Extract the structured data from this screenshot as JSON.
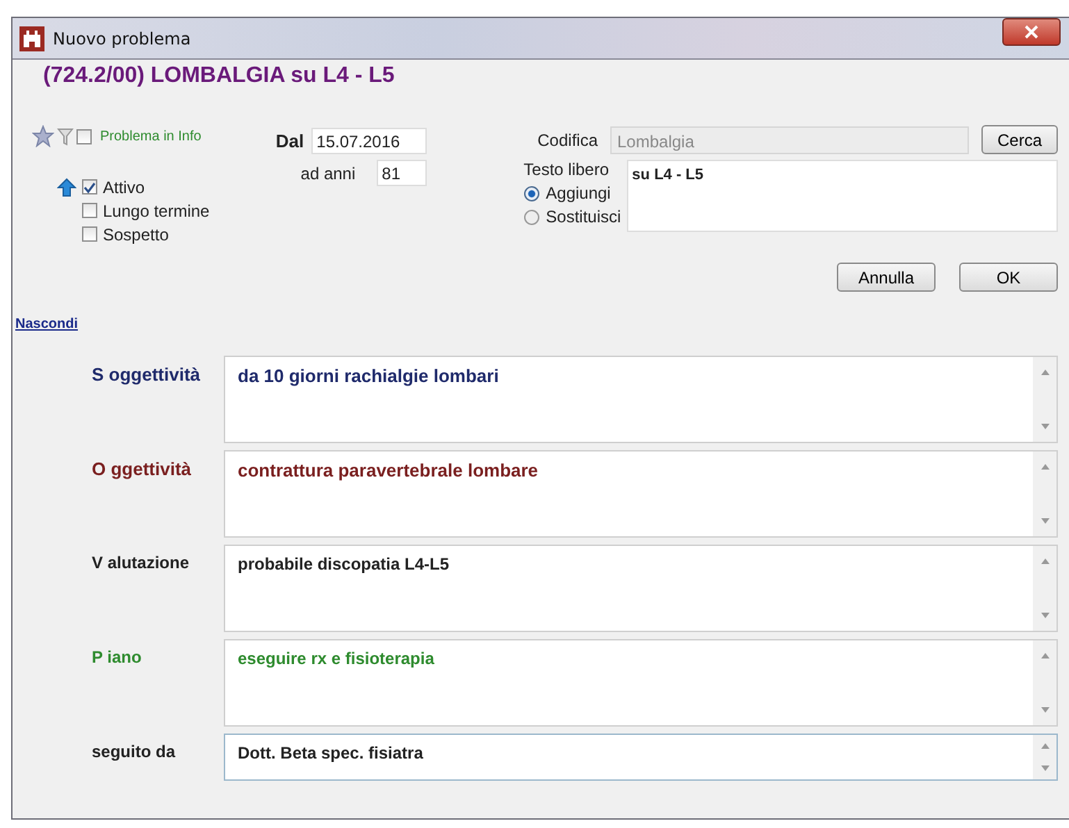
{
  "window": {
    "title": "Nuovo problema"
  },
  "heading": "(724.2/00) LOMBALGIA su L4 - L5",
  "info": {
    "label": "Problema in Info",
    "checked": false
  },
  "flags": [
    {
      "label": "Attivo",
      "checked": true
    },
    {
      "label": "Lungo termine",
      "checked": false
    },
    {
      "label": "Sospetto",
      "checked": false
    }
  ],
  "dal": {
    "label": "Dal",
    "value": "15.07.2016"
  },
  "ad_anni": {
    "label": "ad anni",
    "value": "81"
  },
  "codifica": {
    "label": "Codifica",
    "value": "Lombalgia",
    "disabled": true
  },
  "testo_libero": {
    "label": "Testo libero",
    "value": "su L4 - L5"
  },
  "mode_options": [
    {
      "label": "Aggiungi",
      "selected": true
    },
    {
      "label": "Sostituisci",
      "selected": false
    }
  ],
  "buttons": {
    "search": "Cerca",
    "cancel": "Annulla",
    "ok": "OK"
  },
  "link": "Nascondi",
  "sections": [
    {
      "label": "S oggettività",
      "value": "da 10 giorni rachialgie lombari",
      "color": "#1f2a6b"
    },
    {
      "label": "O ggettività",
      "value": "contrattura paravertebrale lombare",
      "color": "#7a1f1f"
    },
    {
      "label": "V alutazione",
      "value": "probabile discopatia L4-L5",
      "color": "#222222"
    },
    {
      "label": "P iano",
      "value": "eseguire rx e fisioterapia",
      "color": "#2e8b2e"
    },
    {
      "label": "seguito da",
      "value": "Dott. Beta spec. fisiatra",
      "color": "#222222"
    }
  ]
}
